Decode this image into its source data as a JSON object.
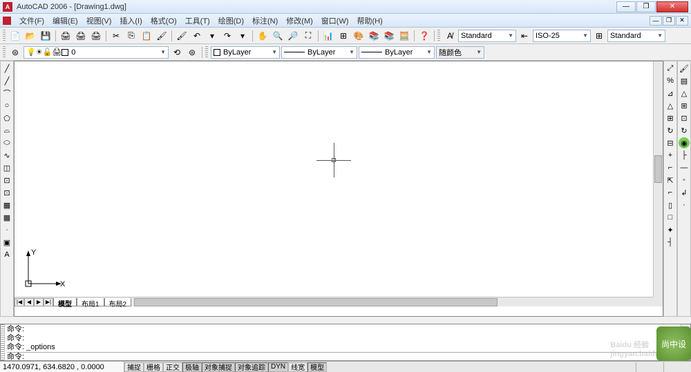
{
  "title": "AutoCAD 2006 - [Drawing1.dwg]",
  "menus": [
    "文件(F)",
    "编辑(E)",
    "视图(V)",
    "插入(I)",
    "格式(O)",
    "工具(T)",
    "绘图(D)",
    "标注(N)",
    "修改(M)",
    "窗口(W)",
    "帮助(H)"
  ],
  "style_dropdowns": {
    "text_style": "Standard",
    "dim_style": "ISO-25",
    "table_style": "Standard"
  },
  "layer_row": {
    "current_layer": "0",
    "color_selector": "ByLayer",
    "linetype_selector": "ByLayer",
    "lineweight_selector": "ByLayer",
    "plotstyle_selector": "随颜色"
  },
  "layout_tabs": {
    "nav_first": "|◀",
    "nav_prev": "◀",
    "nav_next": "▶",
    "nav_last": "▶|",
    "tabs": [
      "模型",
      "布局1",
      "布局2"
    ],
    "active": 0
  },
  "ucs": {
    "x_label": "X",
    "y_label": "Y",
    "origin": "▷"
  },
  "command_history": [
    "命令:",
    "命令:",
    "命令: _options"
  ],
  "command_prompt": "命令:",
  "statusbar": {
    "coords": "1470.0971, 634.6820 , 0.0000",
    "buttons": [
      "捕捉",
      "栅格",
      "正交",
      "极轴",
      "对象捕捉",
      "对象追踪",
      "DYN",
      "线宽",
      "模型"
    ]
  },
  "left_tools": [
    "╱",
    "╱",
    "⌒",
    "○",
    "⬠",
    "⌓",
    "⬭",
    "∿",
    "◫",
    "⊡",
    "⊡",
    "▦",
    "▦",
    "·",
    "▣",
    "A"
  ],
  "right_tools1": [
    "⤢",
    "%",
    "⊿",
    "△",
    "⊞",
    "↻",
    "⊟",
    "+",
    "⌐",
    "⇱",
    "⌐",
    "▯",
    "□",
    "✦",
    "┤"
  ],
  "right_tools2": [
    "🖌",
    "▤",
    "△",
    "⊞",
    "⊡",
    "↻",
    "◉",
    "├",
    "—",
    "◦",
    "↲",
    "·"
  ],
  "watermark": "Baidu 经验",
  "watermark_sub": "jingyan.baidu.com",
  "corner_badge": "尚中设"
}
